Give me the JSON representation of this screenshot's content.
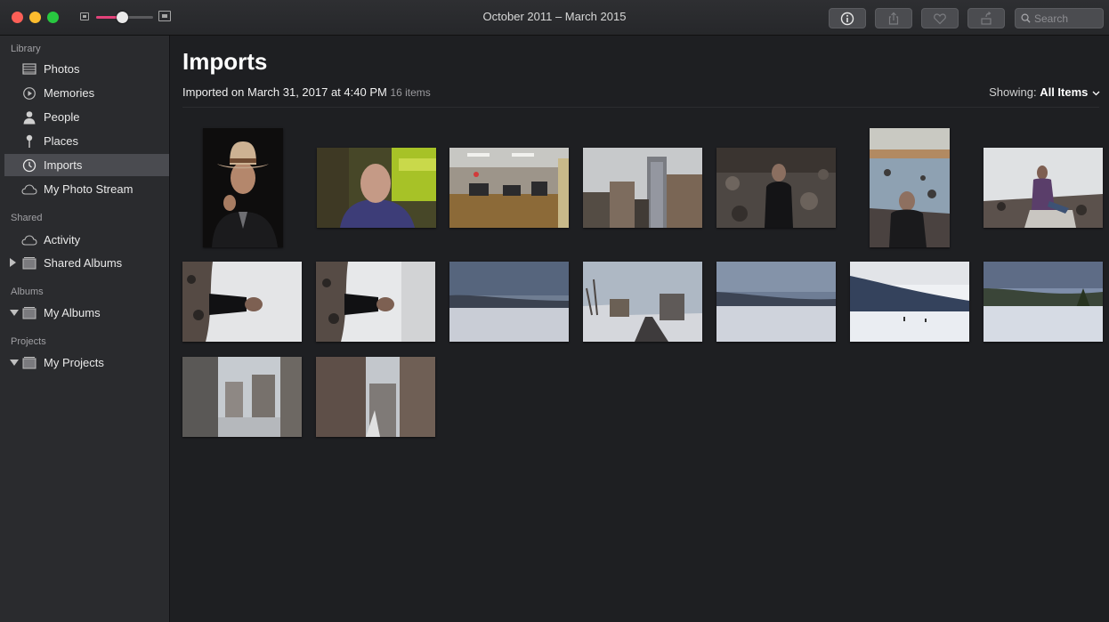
{
  "window": {
    "title": "October 2011 – March 2015",
    "search_placeholder": "Search",
    "zoom_level": 0.45
  },
  "toolbar": {
    "buttons": [
      {
        "icon": "info-icon"
      },
      {
        "icon": "share-icon"
      },
      {
        "icon": "heart-icon"
      },
      {
        "icon": "rotate-icon"
      }
    ]
  },
  "sidebar": {
    "sections": [
      {
        "label": "Library",
        "items": [
          {
            "label": "Photos",
            "icon": "photos-icon"
          },
          {
            "label": "Memories",
            "icon": "memories-icon"
          },
          {
            "label": "People",
            "icon": "people-icon"
          },
          {
            "label": "Places",
            "icon": "places-icon"
          },
          {
            "label": "Imports",
            "icon": "imports-icon",
            "selected": true
          },
          {
            "label": "My Photo Stream",
            "icon": "cloud-icon"
          }
        ]
      },
      {
        "label": "Shared",
        "items": [
          {
            "label": "Activity",
            "icon": "cloud-icon"
          },
          {
            "label": "Shared Albums",
            "icon": "album-icon",
            "disclosure": "collapsed"
          }
        ]
      },
      {
        "label": "Albums",
        "items": [
          {
            "label": "My Albums",
            "icon": "album-icon",
            "disclosure": "expanded"
          }
        ]
      },
      {
        "label": "Projects",
        "items": [
          {
            "label": "My Projects",
            "icon": "album-icon",
            "disclosure": "expanded"
          }
        ]
      }
    ]
  },
  "main": {
    "title": "Imports",
    "subtitle_prefix": "Imported on ",
    "subtitle_date": "March 31, 2017 at 4:40 PM",
    "item_count": "16 items",
    "showing_label": "Showing:",
    "showing_value": "All Items",
    "photos": [
      {
        "kind": "portrait-cowboy"
      },
      {
        "kind": "bald-man"
      },
      {
        "kind": "office"
      },
      {
        "kind": "buildings-sky"
      },
      {
        "kind": "man-rocks"
      },
      {
        "kind": "man-rocks-portrait"
      },
      {
        "kind": "woman-rocks"
      },
      {
        "kind": "rotated-man-1"
      },
      {
        "kind": "rotated-man-2"
      },
      {
        "kind": "frozen-lake-1"
      },
      {
        "kind": "snowy-street"
      },
      {
        "kind": "frozen-lake-2"
      },
      {
        "kind": "frozen-lake-3"
      },
      {
        "kind": "frozen-lake-4"
      },
      {
        "kind": "city-aerial-1"
      },
      {
        "kind": "city-aerial-2"
      }
    ]
  }
}
